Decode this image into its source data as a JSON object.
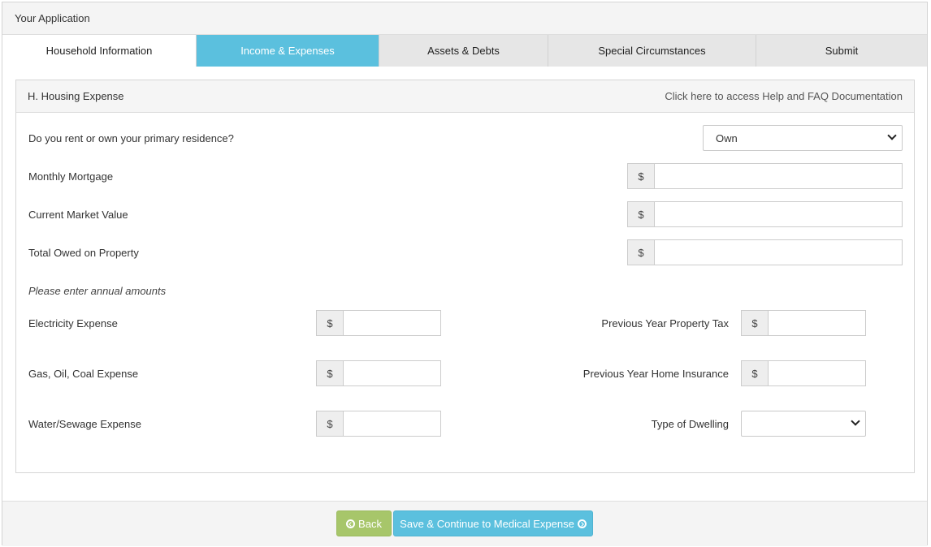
{
  "app": {
    "title": "Your Application"
  },
  "tabs": [
    {
      "label": "Household Information"
    },
    {
      "label": "Income & Expenses",
      "active": true
    },
    {
      "label": "Assets & Debts"
    },
    {
      "label": "Special Circumstances"
    },
    {
      "label": "Submit"
    }
  ],
  "panel": {
    "title": "H. Housing Expense",
    "help_link": "Click here to access Help and FAQ Documentation"
  },
  "form": {
    "rent_own": {
      "label": "Do you rent or own your primary residence?",
      "value": "Own"
    },
    "monthly_mortgage": {
      "label": "Monthly Mortgage",
      "currency": "$",
      "value": ""
    },
    "market_value": {
      "label": "Current Market Value",
      "currency": "$",
      "value": ""
    },
    "total_owed": {
      "label": "Total Owed on Property",
      "currency": "$",
      "value": ""
    },
    "annual_note": "Please enter annual amounts",
    "electricity": {
      "label": "Electricity Expense",
      "currency": "$",
      "value": ""
    },
    "gas_oil_coal": {
      "label": "Gas, Oil, Coal Expense",
      "currency": "$",
      "value": ""
    },
    "water_sewage": {
      "label": "Water/Sewage Expense",
      "currency": "$",
      "value": ""
    },
    "property_tax": {
      "label": "Previous Year Property Tax",
      "currency": "$",
      "value": ""
    },
    "home_insurance": {
      "label": "Previous Year Home Insurance",
      "currency": "$",
      "value": ""
    },
    "dwelling_type": {
      "label": "Type of Dwelling",
      "value": ""
    }
  },
  "footer": {
    "back_label": "Back",
    "save_label": "Save & Continue to Medical Expense"
  },
  "colors": {
    "accent": "#5bc0de",
    "back_button": "#a7c66a",
    "header_bg": "#f4f4f4",
    "inactive_tab": "#e6e6e6"
  },
  "icons": {
    "back": "circle-arrow-left-icon",
    "save": "circle-arrow-right-icon",
    "select": "chevron-down-icon"
  }
}
